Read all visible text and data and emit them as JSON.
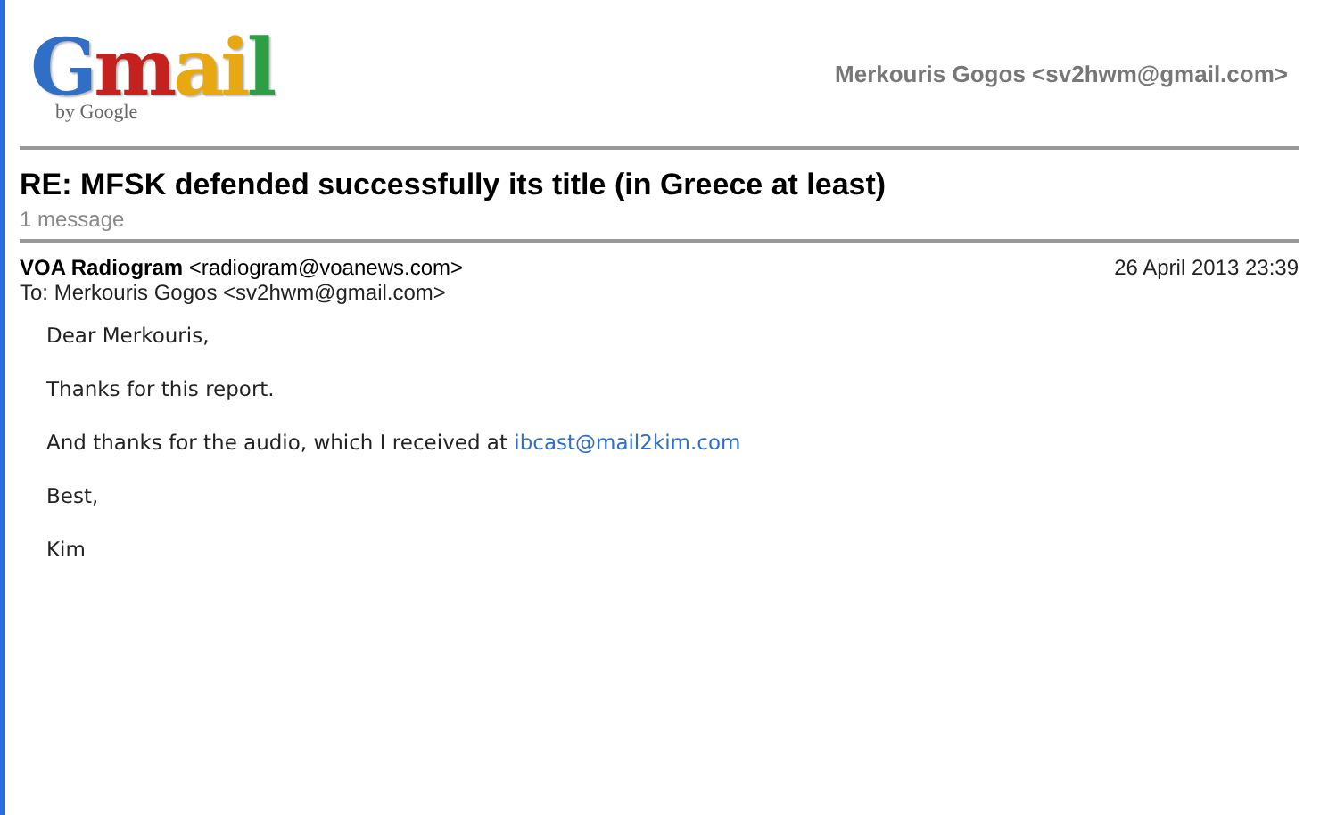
{
  "logo": {
    "text": "Gmail",
    "byline": "by Google"
  },
  "account": "Merkouris Gogos <sv2hwm@gmail.com>",
  "subject": "RE: MFSK defended successfully its title (in Greece at least)",
  "message_count": "1 message",
  "message": {
    "sender_name": "VOA Radiogram",
    "sender_address": "<radiogram@voanews.com>",
    "date": "26 April 2013 23:39",
    "to": "To: Merkouris Gogos <sv2hwm@gmail.com>",
    "body": [
      {
        "text": "Dear Merkouris,"
      },
      {
        "text": "Thanks for this report."
      },
      {
        "text": "And thanks for the audio, which I received at",
        "link": "ibcast@mail2kim.com"
      },
      {
        "text": "Best,"
      },
      {
        "text": "Kim"
      }
    ]
  }
}
